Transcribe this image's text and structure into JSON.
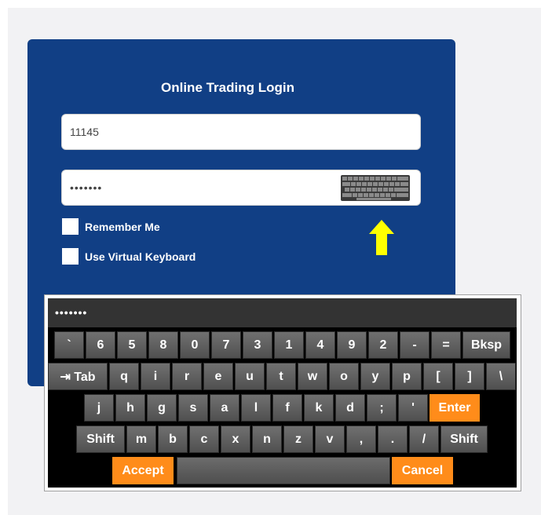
{
  "login": {
    "title": "Online Trading Login",
    "username_value": "11145",
    "password_value": "•••••••",
    "remember_label": "Remember Me",
    "virtual_keyboard_label": "Use Virtual Keyboard"
  },
  "colors": {
    "card": "#113f85",
    "accent_orange": "#ff8c1a",
    "arrow_yellow": "#ffff00"
  },
  "icons": {
    "keyboard_toggle": "keyboard-thumbnail-icon",
    "hint_arrow": "arrow-up-icon"
  },
  "keyboard": {
    "display_value": "•••••••",
    "rows": [
      [
        "`",
        "6",
        "5",
        "8",
        "0",
        "7",
        "3",
        "1",
        "4",
        "9",
        "2",
        "-",
        "=",
        "Bksp"
      ],
      [
        "⇥ Tab",
        "q",
        "i",
        "r",
        "e",
        "u",
        "t",
        "w",
        "o",
        "y",
        "p",
        "[",
        "]",
        "\\"
      ],
      [
        "j",
        "h",
        "g",
        "s",
        "a",
        "l",
        "f",
        "k",
        "d",
        ";",
        "'",
        "Enter"
      ],
      [
        "Shift",
        "m",
        "b",
        "c",
        "x",
        "n",
        "z",
        "v",
        ",",
        ".",
        "/",
        "Shift"
      ],
      [
        "Accept",
        "",
        "Cancel"
      ]
    ]
  }
}
